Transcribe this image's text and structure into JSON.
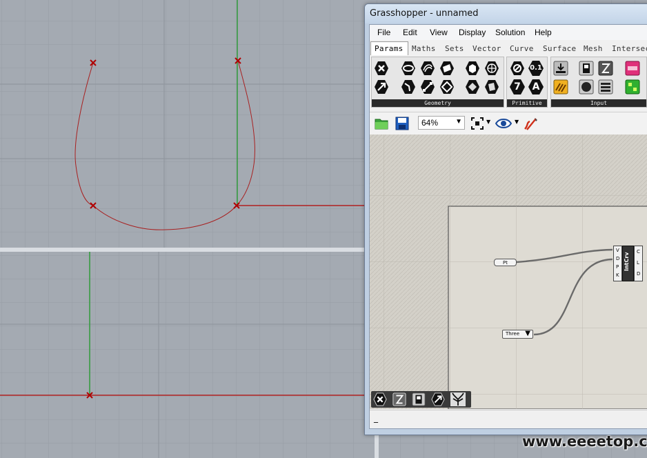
{
  "window": {
    "title": "Grasshopper - unnamed"
  },
  "menu": [
    "File",
    "Edit",
    "View",
    "Display",
    "Solution",
    "Help"
  ],
  "tabs": [
    "Params",
    "Maths",
    "Sets",
    "Vector",
    "Curve",
    "Surface",
    "Mesh",
    "Intersect"
  ],
  "ribbon_groups": {
    "geometry": "Geometry",
    "primitive": "Primitive",
    "input": "Input"
  },
  "primitive_icons": {
    "number_label": "0.1",
    "integer_label": "7",
    "text_label": "A"
  },
  "toolbar": {
    "zoom": "64%"
  },
  "components": {
    "pt_param": "Pt",
    "value_list": "Three",
    "intcrv": {
      "name": "IntCrv",
      "inputs": [
        "V",
        "D",
        "P",
        "K"
      ],
      "outputs": [
        "C",
        "L",
        "D"
      ]
    }
  },
  "status": {
    "text": "_"
  },
  "watermark": "www.eeeetop.com",
  "colors": {
    "viewport_bg": "#a4aab2",
    "grid_line": "#959ba3",
    "x_axis": "#b02020",
    "y_axis": "#2f9a3a",
    "curve": "#a82020",
    "canvas_bg": "#d4d1c9"
  }
}
